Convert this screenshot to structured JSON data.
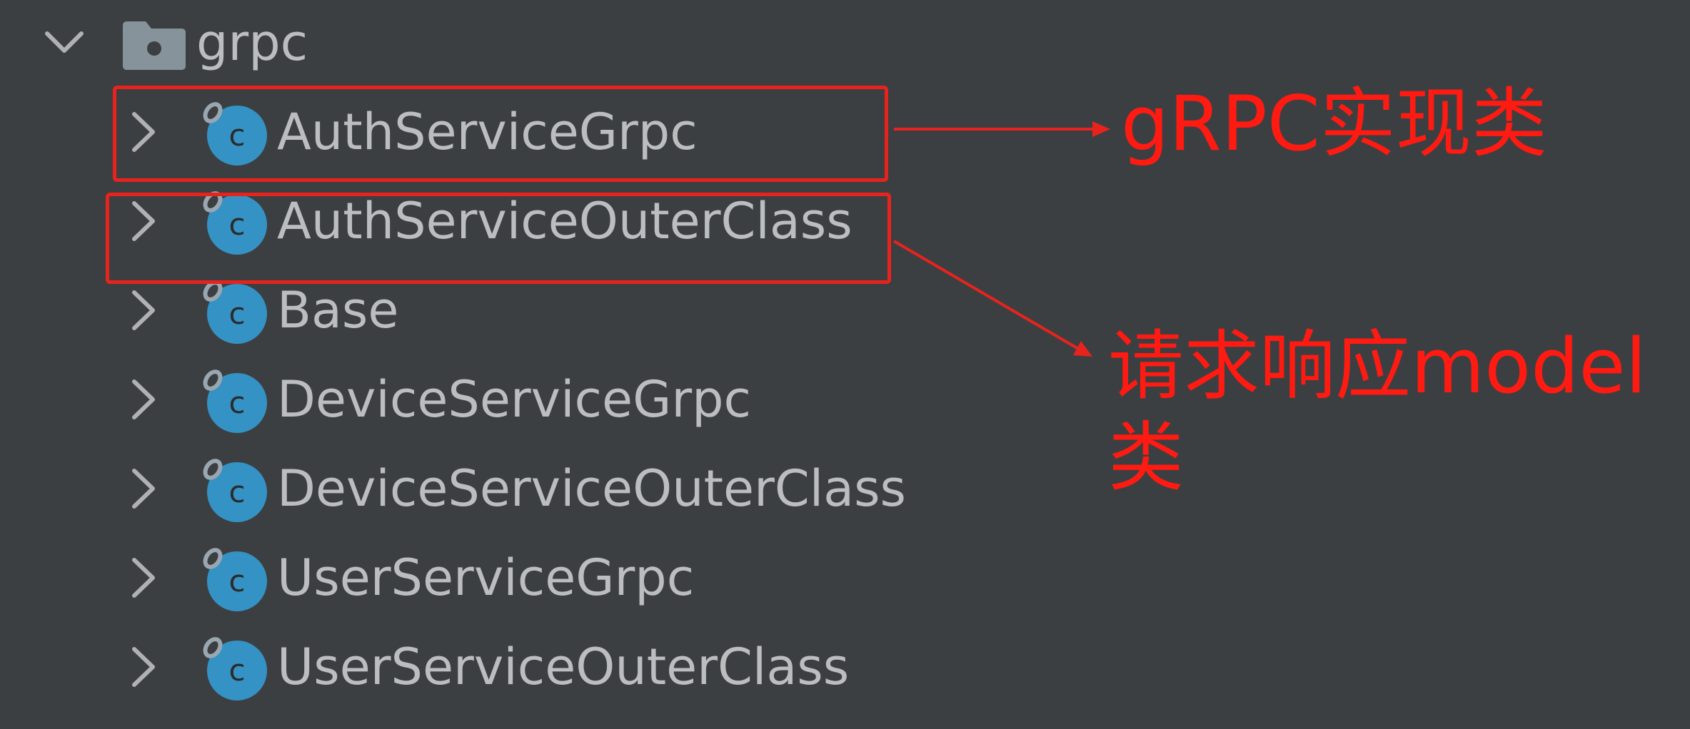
{
  "tree": {
    "folder": {
      "label": "grpc",
      "expanded": true,
      "icon": "folder-icon"
    },
    "items": [
      {
        "label": "AuthServiceGrpc",
        "icon": "java-class-icon",
        "expanded": false
      },
      {
        "label": "AuthServiceOuterClass",
        "icon": "java-class-icon",
        "expanded": false
      },
      {
        "label": "Base",
        "icon": "java-class-icon",
        "expanded": false
      },
      {
        "label": "DeviceServiceGrpc",
        "icon": "java-class-icon",
        "expanded": false
      },
      {
        "label": "DeviceServiceOuterClass",
        "icon": "java-class-icon",
        "expanded": false
      },
      {
        "label": "UserServiceGrpc",
        "icon": "java-class-icon",
        "expanded": false
      },
      {
        "label": "UserServiceOuterClass",
        "icon": "java-class-icon",
        "expanded": false
      }
    ]
  },
  "annotations": {
    "grpc_impl_note": "gRPC实现类",
    "model_note_line1": "请求响应model",
    "model_note_line2": "类"
  },
  "colors": {
    "background": "#3c3f41",
    "text": "#bbbdbf",
    "class_icon": "#3592c4",
    "annotation": "#e8231d"
  }
}
